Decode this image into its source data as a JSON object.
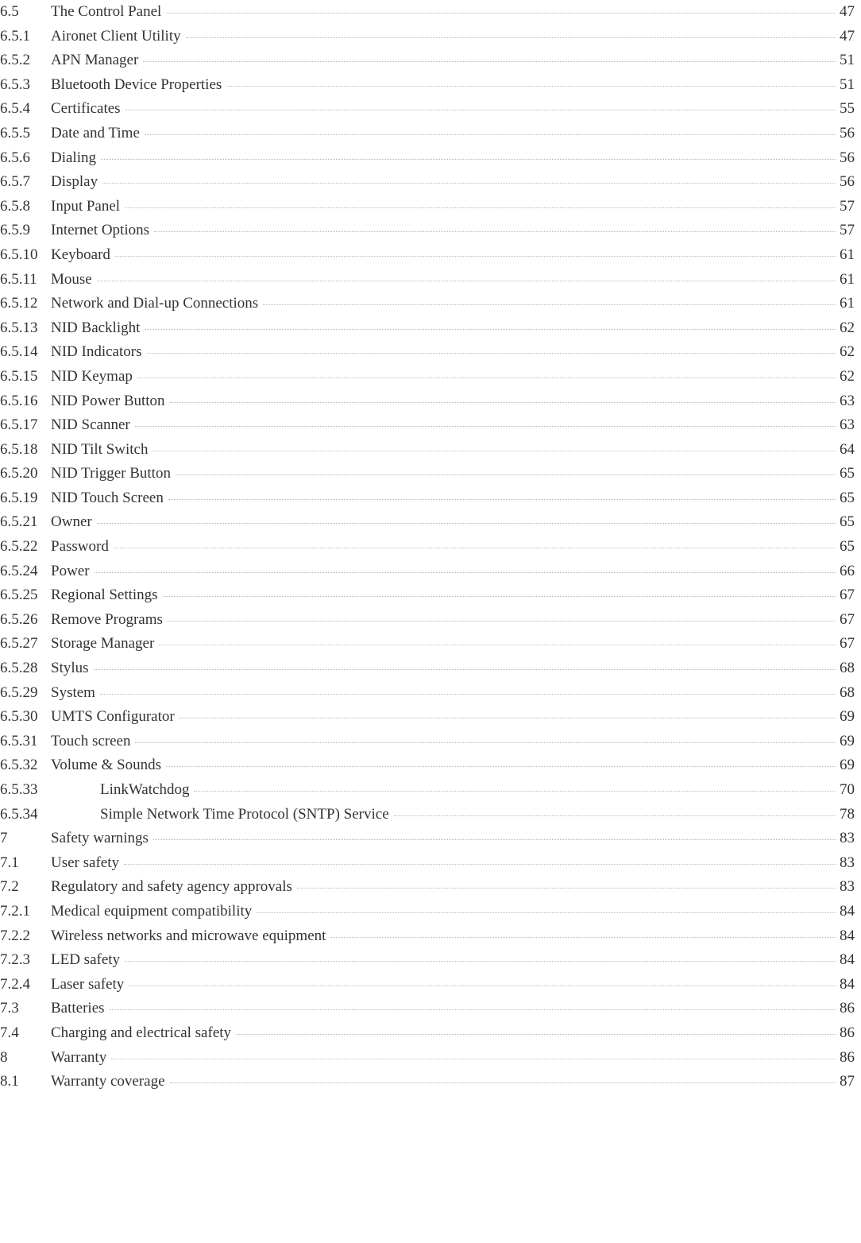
{
  "toc": [
    {
      "num": "6.5",
      "title": "The Control Panel",
      "page": "47",
      "indent": 0
    },
    {
      "num": "6.5.1",
      "title": "Aironet Client Utility",
      "page": "47",
      "indent": 0
    },
    {
      "num": "6.5.2",
      "title": "APN Manager",
      "page": "51",
      "indent": 0
    },
    {
      "num": "6.5.3",
      "title": "Bluetooth Device Properties",
      "page": "51",
      "indent": 0
    },
    {
      "num": "6.5.4",
      "title": "Certificates",
      "page": "55",
      "indent": 0
    },
    {
      "num": "6.5.5",
      "title": "Date and Time",
      "page": "56",
      "indent": 0
    },
    {
      "num": "6.5.6",
      "title": "Dialing",
      "page": "56",
      "indent": 0
    },
    {
      "num": "6.5.7",
      "title": "Display",
      "page": "56",
      "indent": 0
    },
    {
      "num": "6.5.8",
      "title": "Input Panel",
      "page": "57",
      "indent": 0
    },
    {
      "num": "6.5.9",
      "title": "Internet Options",
      "page": "57",
      "indent": 0
    },
    {
      "num": "6.5.10",
      "title": "Keyboard",
      "page": "61",
      "indent": 0
    },
    {
      "num": "6.5.11",
      "title": "Mouse",
      "page": "61",
      "indent": 0
    },
    {
      "num": "6.5.12",
      "title": "Network and Dial-up Connections",
      "page": "61",
      "indent": 0
    },
    {
      "num": "6.5.13",
      "title": "NID Backlight",
      "page": "62",
      "indent": 0
    },
    {
      "num": "6.5.14",
      "title": "NID Indicators",
      "page": "62",
      "indent": 0
    },
    {
      "num": "6.5.15",
      "title": "NID Keymap",
      "page": "62",
      "indent": 0
    },
    {
      "num": "6.5.16",
      "title": "NID Power Button",
      "page": "63",
      "indent": 0
    },
    {
      "num": "6.5.17",
      "title": "NID Scanner",
      "page": "63",
      "indent": 0
    },
    {
      "num": "6.5.18",
      "title": "NID Tilt Switch",
      "page": "64",
      "indent": 0
    },
    {
      "num": "6.5.20",
      "title": "NID Trigger Button",
      "page": "65",
      "indent": 0
    },
    {
      "num": "6.5.19",
      "title": "NID Touch Screen",
      "page": "65",
      "indent": 0
    },
    {
      "num": "6.5.21",
      "title": "Owner",
      "page": "65",
      "indent": 0
    },
    {
      "num": "6.5.22",
      "title": "Password",
      "page": "65",
      "indent": 0
    },
    {
      "num": "6.5.24",
      "title": "Power",
      "page": "66",
      "indent": 0
    },
    {
      "num": "6.5.25",
      "title": "Regional Settings",
      "page": "67",
      "indent": 0
    },
    {
      "num": "6.5.26",
      "title": "Remove Programs",
      "page": "67",
      "indent": 0
    },
    {
      "num": "6.5.27",
      "title": "Storage Manager",
      "page": "67",
      "indent": 0
    },
    {
      "num": "6.5.28",
      "title": "Stylus",
      "page": "68",
      "indent": 0
    },
    {
      "num": "6.5.29",
      "title": "System",
      "page": "68",
      "indent": 0
    },
    {
      "num": "6.5.30",
      "title": "UMTS Configurator",
      "page": "69",
      "indent": 0
    },
    {
      "num": "6.5.31",
      "title": "Touch screen",
      "page": "69",
      "indent": 0
    },
    {
      "num": "6.5.32",
      "title": "Volume & Sounds",
      "page": "69",
      "indent": 0
    },
    {
      "num": "6.5.33",
      "title": "LinkWatchdog",
      "page": "70",
      "indent": 1
    },
    {
      "num": "6.5.34",
      "title": "Simple Network Time Protocol (SNTP) Service",
      "page": "78",
      "indent": 1
    },
    {
      "num": "7",
      "title": "Safety warnings",
      "page": "83",
      "indent": 0
    },
    {
      "num": "7.1",
      "title": "User safety",
      "page": "83",
      "indent": 0
    },
    {
      "num": "7.2",
      "title": "Regulatory and safety agency approvals",
      "page": "83",
      "indent": 0
    },
    {
      "num": "7.2.1",
      "title": "Medical equipment compatibility",
      "page": "84",
      "indent": 0
    },
    {
      "num": "7.2.2",
      "title": "Wireless networks and microwave equipment",
      "page": "84",
      "indent": 0
    },
    {
      "num": "7.2.3",
      "title": "LED safety",
      "page": "84",
      "indent": 0
    },
    {
      "num": "7.2.4",
      "title": "Laser safety",
      "page": "84",
      "indent": 0
    },
    {
      "num": "7.3",
      "title": "Batteries",
      "page": "86",
      "indent": 0
    },
    {
      "num": "7.4",
      "title": "Charging and electrical safety",
      "page": "86",
      "indent": 0
    },
    {
      "num": "8",
      "title": "Warranty",
      "page": "86",
      "indent": 0
    },
    {
      "num": "8.1",
      "title": "Warranty coverage",
      "page": "87",
      "indent": 0
    }
  ]
}
